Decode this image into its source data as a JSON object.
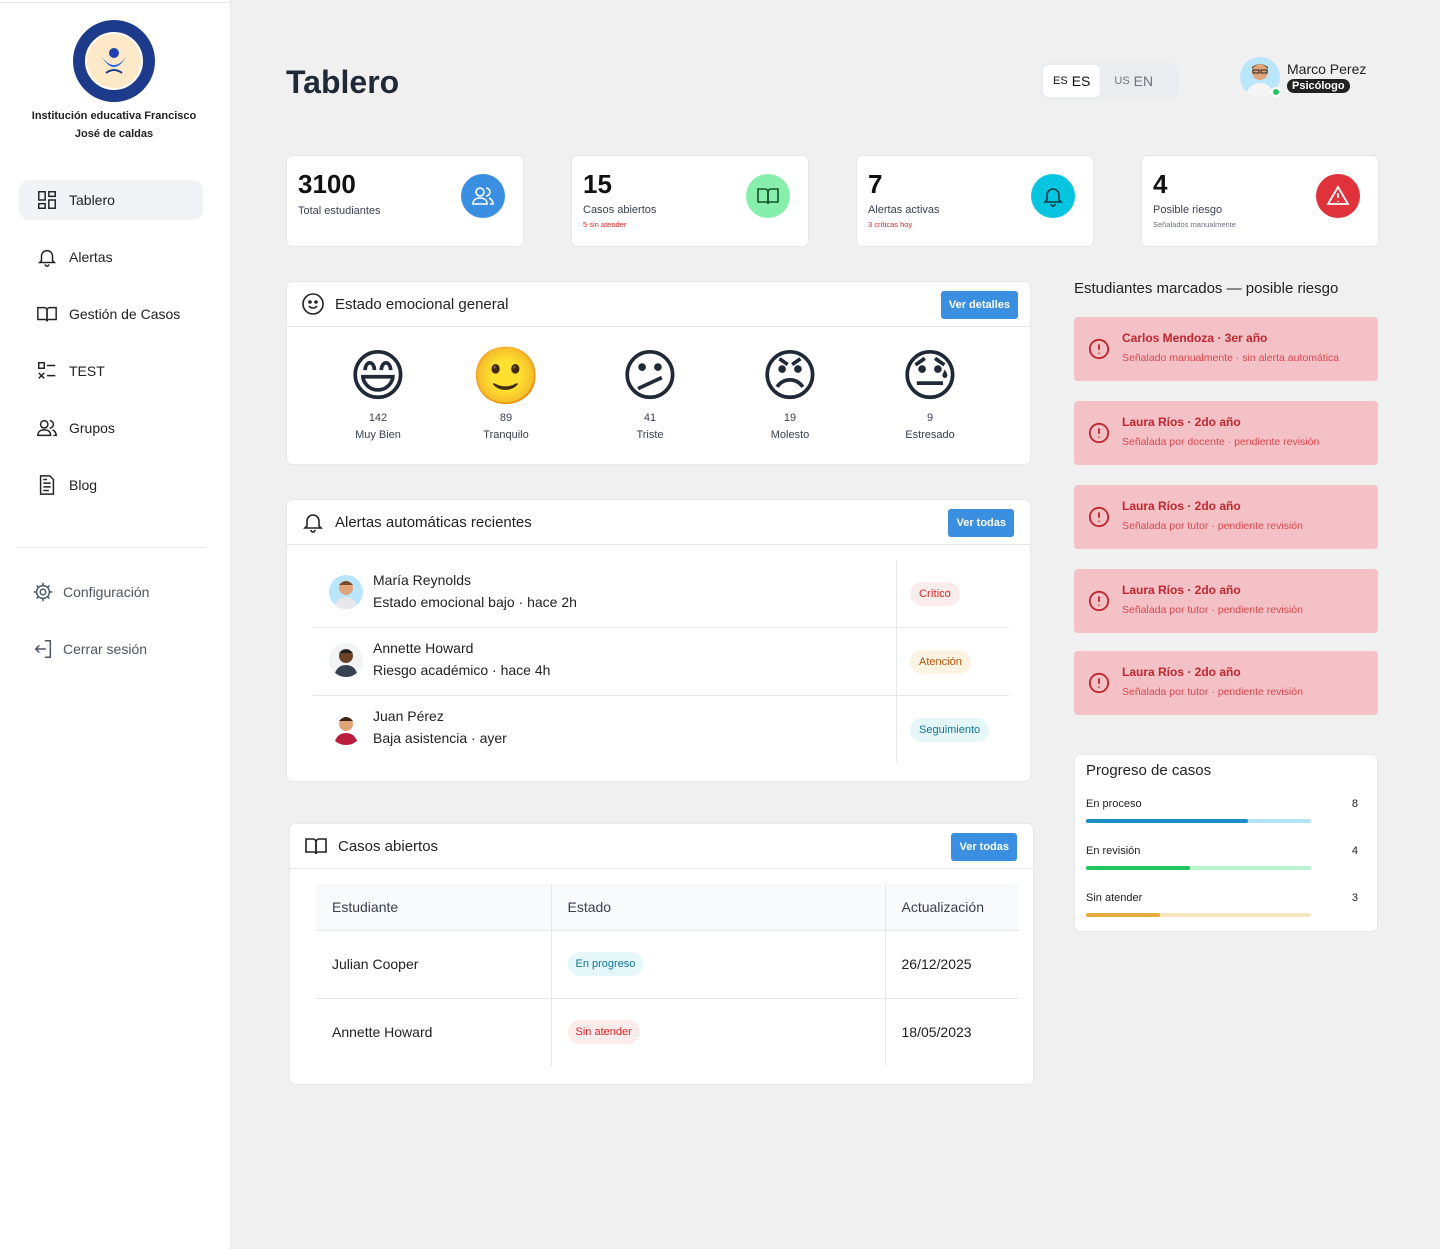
{
  "sidebar": {
    "institution": "Institución educativa Francisco José de caldas",
    "nav": [
      {
        "label": "Tablero",
        "icon": "dashboard-icon"
      },
      {
        "label": "Alertas",
        "icon": "bell-icon"
      },
      {
        "label": "Gestión de Casos",
        "icon": "book-icon"
      },
      {
        "label": "TEST",
        "icon": "checklist-icon"
      },
      {
        "label": "Grupos",
        "icon": "users-icon"
      },
      {
        "label": "Blog",
        "icon": "document-icon"
      }
    ],
    "settings": "Configuración",
    "logout": "Cerrar sesión"
  },
  "header": {
    "title": "Tablero",
    "lang": [
      {
        "flag": "ES",
        "label": "ES"
      },
      {
        "flag": "US",
        "label": "EN"
      }
    ],
    "user": {
      "name": "Marco Perez",
      "role": "Psicólogo"
    }
  },
  "stats": [
    {
      "value": "3100",
      "label": "Total estudiantes",
      "sub": "",
      "color": "#3b8fe0"
    },
    {
      "value": "15",
      "label": "Casos abiertos",
      "sub": "5 sin atender",
      "color": "#86efac"
    },
    {
      "value": "7",
      "label": "Alertas activas",
      "sub": "3 críticas hoy",
      "color": "#06c5e0"
    },
    {
      "value": "4",
      "label": "Posible riesgo",
      "sub": "Señalados manualmente",
      "color": "#e0323a"
    }
  ],
  "emotional": {
    "title": "Estado emocional general",
    "button": "Ver detalles",
    "items": [
      {
        "face": "😄",
        "count": "142",
        "name": "Muy Bien"
      },
      {
        "face": "🙂",
        "count": "89",
        "name": "Tranquilo"
      },
      {
        "face": "😕",
        "count": "41",
        "name": "Triste"
      },
      {
        "face": "😠",
        "count": "19",
        "name": "Molesto"
      },
      {
        "face": "😓",
        "count": "9",
        "name": "Estresado"
      }
    ]
  },
  "alerts": {
    "title": "Alertas automáticas recientes",
    "button": "Ver todas",
    "rows": [
      {
        "name": "María Reynolds",
        "desc": "Estado emocional bajo · hace 2h",
        "tag": "Crítico"
      },
      {
        "name": "Annette Howard",
        "desc": "Riesgo académico · hace 4h",
        "tag": "Atención"
      },
      {
        "name": "Juan Pérez",
        "desc": "Baja asistencia · ayer",
        "tag": "Seguimiento"
      }
    ]
  },
  "cases": {
    "title": "Casos abiertos",
    "button": "Ver todas",
    "headers": [
      "Estudiante",
      "Estado",
      "Actualización"
    ],
    "rows": [
      {
        "student": "Julian Cooper",
        "status": "En progreso",
        "date": "26/12/2025"
      },
      {
        "student": "Annette Howard",
        "status": "Sin atender",
        "date": "18/05/2023"
      }
    ]
  },
  "risk": {
    "title": "Estudiantes marcados — posible riesgo",
    "items": [
      {
        "name": "Carlos Mendoza · 3er año",
        "desc": "Señalado manualmente · sin alerta automática"
      },
      {
        "name": "Laura Ríos · 2do año",
        "desc": "Señalada por docente · pendiente revisión"
      },
      {
        "name": "Laura Ríos · 2do año",
        "desc": "Señalada por tutor · pendiente revisión"
      },
      {
        "name": "Laura Ríos · 2do año",
        "desc": "Señalada por tutor · pendiente revisión"
      },
      {
        "name": "Laura Ríos · 2do año",
        "desc": "Señalada por tutor · pendiente revisión"
      }
    ]
  },
  "progress": {
    "title": "Progreso de casos",
    "items": [
      {
        "label": "En proceso",
        "value": "8",
        "fraction": 0.72,
        "color": "#1d8dc7",
        "track": "#b3e3f5"
      },
      {
        "label": "En revisión",
        "value": "4",
        "fraction": 0.46,
        "color": "#22c55e",
        "track": "#bbf2d0"
      },
      {
        "label": "Sin atender",
        "value": "3",
        "fraction": 0.33,
        "color": "#e6ad3e",
        "track": "#f5e6c0"
      }
    ]
  }
}
